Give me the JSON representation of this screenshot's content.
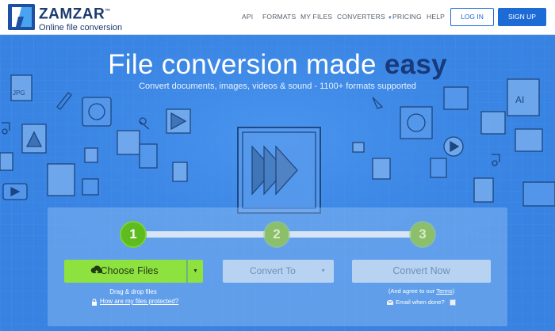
{
  "header": {
    "brand_name": "ZAMZAR",
    "brand_mark": "™",
    "tagline": "Online file conversion",
    "nav": [
      {
        "label": "API"
      },
      {
        "label": "FORMATS"
      },
      {
        "label": "MY FILES"
      },
      {
        "label": "CONVERTERS"
      },
      {
        "label": "PRICING"
      },
      {
        "label": "HELP"
      }
    ],
    "login_label": "LOG IN",
    "signup_label": "SIGN UP"
  },
  "hero": {
    "title_main": "File conversion made",
    "title_accent": "easy",
    "subtitle": "Convert documents, images, videos & sound - 1100+ formats supported"
  },
  "converter": {
    "steps": [
      "1",
      "2",
      "3"
    ],
    "current_step": 1,
    "choose_files_label": "Choose Files",
    "drag_drop": "Drag & drop files",
    "protected_link": "How are my files protected?",
    "convert_to_label": "Convert To",
    "convert_now_label": "Convert Now",
    "agree_prefix": "(And agree to our ",
    "agree_link": "Terms",
    "agree_suffix": ")",
    "email_label": "Email when done?"
  },
  "colors": {
    "brand": "#1d4fa3",
    "accent": "#1d6bd6",
    "hero_bg": "#3b87e7",
    "easy": "#183a7a",
    "green": "#8ee23f"
  },
  "icons": [
    "chevron-down-icon",
    "upload-cloud-icon",
    "lock-icon",
    "email-icon"
  ]
}
